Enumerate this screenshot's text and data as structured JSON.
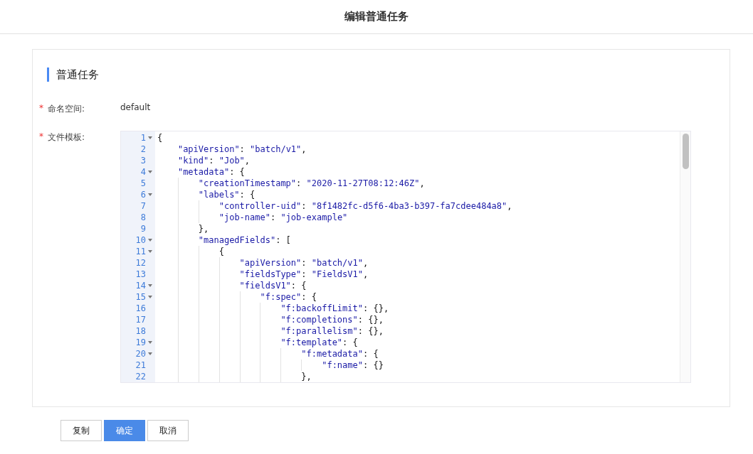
{
  "header": {
    "title": "编辑普通任务"
  },
  "section": {
    "title": "普通任务"
  },
  "fields": [
    {
      "required_mark": "*",
      "label": "命名空间:",
      "kind": "text",
      "value": "default"
    },
    {
      "required_mark": "*",
      "label": "文件模板:",
      "kind": "code"
    }
  ],
  "editor": {
    "lines": [
      {
        "number": "1",
        "foldable": true,
        "text": "{"
      },
      {
        "number": "2",
        "foldable": false,
        "text": "    \"apiVersion\": \"batch/v1\","
      },
      {
        "number": "3",
        "foldable": false,
        "text": "    \"kind\": \"Job\","
      },
      {
        "number": "4",
        "foldable": true,
        "text": "    \"metadata\": {"
      },
      {
        "number": "5",
        "foldable": false,
        "text": "        \"creationTimestamp\": \"2020-11-27T08:12:46Z\","
      },
      {
        "number": "6",
        "foldable": true,
        "text": "        \"labels\": {"
      },
      {
        "number": "7",
        "foldable": false,
        "text": "            \"controller-uid\": \"8f1482fc-d5f6-4ba3-b397-fa7cdee484a8\","
      },
      {
        "number": "8",
        "foldable": false,
        "text": "            \"job-name\": \"job-example\""
      },
      {
        "number": "9",
        "foldable": false,
        "text": "        },"
      },
      {
        "number": "10",
        "foldable": true,
        "text": "        \"managedFields\": ["
      },
      {
        "number": "11",
        "foldable": true,
        "text": "            {"
      },
      {
        "number": "12",
        "foldable": false,
        "text": "                \"apiVersion\": \"batch/v1\","
      },
      {
        "number": "13",
        "foldable": false,
        "text": "                \"fieldsType\": \"FieldsV1\","
      },
      {
        "number": "14",
        "foldable": true,
        "text": "                \"fieldsV1\": {"
      },
      {
        "number": "15",
        "foldable": true,
        "text": "                    \"f:spec\": {"
      },
      {
        "number": "16",
        "foldable": false,
        "text": "                        \"f:backoffLimit\": {},"
      },
      {
        "number": "17",
        "foldable": false,
        "text": "                        \"f:completions\": {},"
      },
      {
        "number": "18",
        "foldable": false,
        "text": "                        \"f:parallelism\": {},"
      },
      {
        "number": "19",
        "foldable": true,
        "text": "                        \"f:template\": {"
      },
      {
        "number": "20",
        "foldable": true,
        "text": "                            \"f:metadata\": {"
      },
      {
        "number": "21",
        "foldable": false,
        "text": "                                \"f:name\": {}"
      },
      {
        "number": "22",
        "foldable": false,
        "text": "                            },"
      }
    ]
  },
  "buttons": [
    {
      "label": "复制",
      "primary": false
    },
    {
      "label": "确定",
      "primary": true
    },
    {
      "label": "取消",
      "primary": false
    }
  ]
}
